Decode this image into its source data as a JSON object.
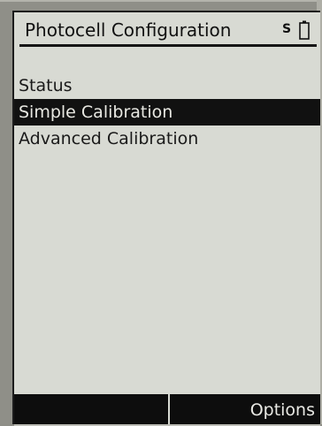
{
  "header": {
    "title": "Photocell Configuration",
    "signal_label": "S",
    "battery_icon": "battery-icon"
  },
  "menu": {
    "items": [
      {
        "label": "Status",
        "selected": false
      },
      {
        "label": "Simple Calibration",
        "selected": true
      },
      {
        "label": "Advanced Calibration",
        "selected": false
      }
    ]
  },
  "softkeys": {
    "left_label": "",
    "right_label": "Options"
  },
  "colors": {
    "screen_background": "#d8dad3",
    "selection_background": "#111111",
    "softkey_background": "#0d0d0d"
  }
}
